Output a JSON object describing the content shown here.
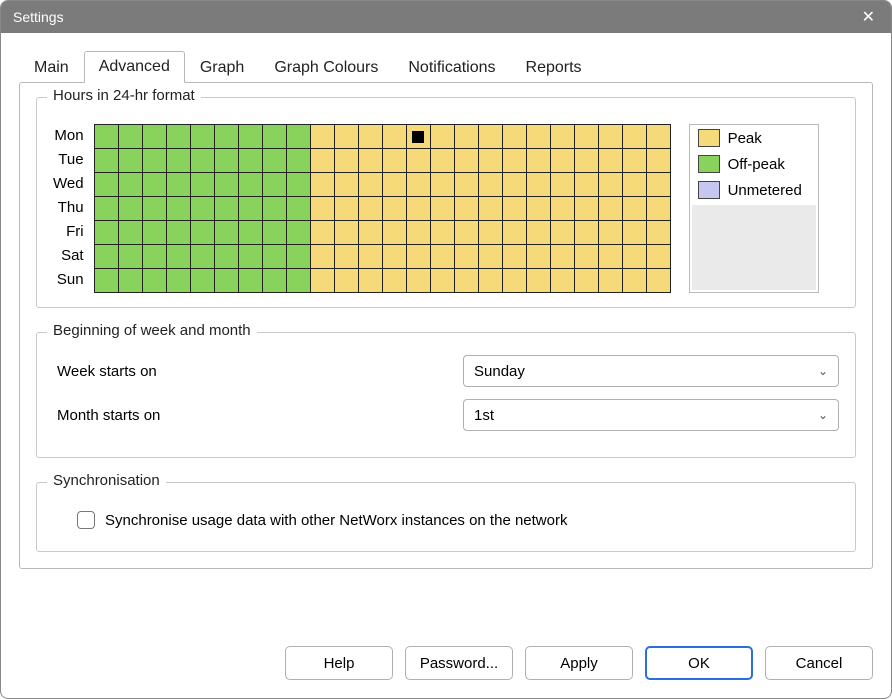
{
  "window": {
    "title": "Settings"
  },
  "tabs": {
    "items": [
      "Main",
      "Advanced",
      "Graph",
      "Graph Colours",
      "Notifications",
      "Reports"
    ],
    "active_index": 1
  },
  "hours_group": {
    "legend": "Hours in 24-hr format",
    "days": [
      "Mon",
      "Tue",
      "Wed",
      "Thu",
      "Fri",
      "Sat",
      "Sun"
    ],
    "off_peak_end_hour": 9,
    "marker": {
      "day_index": 0,
      "hour_index": 13
    },
    "legend_items": {
      "peak": "Peak",
      "off_peak": "Off-peak",
      "unmetered": "Unmetered"
    }
  },
  "week_group": {
    "legend": "Beginning of week and month",
    "week_label": "Week starts on",
    "week_value": "Sunday",
    "month_label": "Month starts on",
    "month_value": "1st"
  },
  "sync_group": {
    "legend": "Synchronisation",
    "checkbox_label": "Synchronise usage data with other NetWorx instances on the network",
    "checked": false
  },
  "buttons": {
    "help": "Help",
    "password": "Password...",
    "apply": "Apply",
    "ok": "OK",
    "cancel": "Cancel"
  }
}
